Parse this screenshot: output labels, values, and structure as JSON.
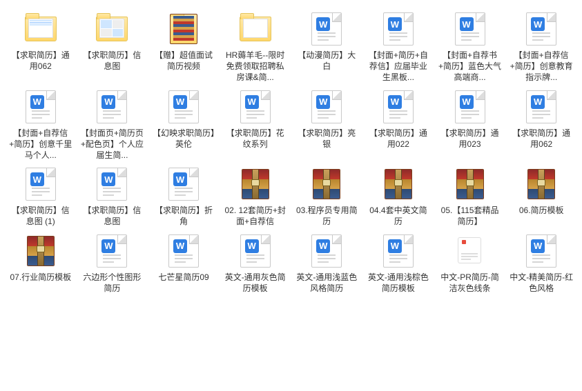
{
  "files": [
    {
      "type": "folder",
      "label": "【求职简历】通用062",
      "thumb": "blue"
    },
    {
      "type": "folder",
      "label": "【求职简历】信息图",
      "thumb": "grid"
    },
    {
      "type": "folder",
      "label": "【赠】超值面试简历视频",
      "thumb": "rar"
    },
    {
      "type": "folder",
      "label": "HR薅羊毛--限时免费领取招聘私房课&简...",
      "thumb": "plain"
    },
    {
      "type": "doc",
      "label": "【动漫简历】大白"
    },
    {
      "type": "doc",
      "label": "【封面+简历+自荐信】应届毕业生黑板..."
    },
    {
      "type": "doc",
      "label": "【封面+自荐书+简历】蓝色大气高端商..."
    },
    {
      "type": "doc",
      "label": "【封面+自荐信+简历】创意教育指示牌..."
    },
    {
      "type": "doc",
      "label": "【封面+自荐信+简历】创意千里马个人..."
    },
    {
      "type": "doc",
      "label": "【封面页+简历页+配色页】个人应届生简..."
    },
    {
      "type": "doc",
      "label": "【幻映求职简历】英伦"
    },
    {
      "type": "doc",
      "label": "【求职简历】花纹系列"
    },
    {
      "type": "doc",
      "label": "【求职简历】亮银"
    },
    {
      "type": "doc",
      "label": "【求职简历】通用022"
    },
    {
      "type": "doc",
      "label": "【求职简历】通用023"
    },
    {
      "type": "doc",
      "label": "【求职简历】通用062"
    },
    {
      "type": "doc",
      "label": "【求职简历】信息图 (1)"
    },
    {
      "type": "doc",
      "label": "【求职简历】信息图"
    },
    {
      "type": "doc",
      "label": "【求职简历】折角"
    },
    {
      "type": "rar",
      "label": "02. 12套简历+封面+自荐信"
    },
    {
      "type": "rar",
      "label": "03.程序员专用简历"
    },
    {
      "type": "rar",
      "label": "04.4套中英文简历"
    },
    {
      "type": "rar",
      "label": "05.【115套精品简历】"
    },
    {
      "type": "rar",
      "label": "06.简历模板"
    },
    {
      "type": "rar",
      "label": "07.行业简历模板"
    },
    {
      "type": "doc",
      "label": "六边形个性图形简历"
    },
    {
      "type": "doc",
      "label": "七芒星简历09"
    },
    {
      "type": "doc",
      "label": "英文-通用灰色简历模板"
    },
    {
      "type": "doc",
      "label": "英文-通用浅蓝色风格简历"
    },
    {
      "type": "doc",
      "label": "英文-通用浅棕色简历模板"
    },
    {
      "type": "wps",
      "label": "中文-PR简历-简洁灰色线条"
    },
    {
      "type": "doc",
      "label": "中文-精美简历-红色风格"
    }
  ]
}
